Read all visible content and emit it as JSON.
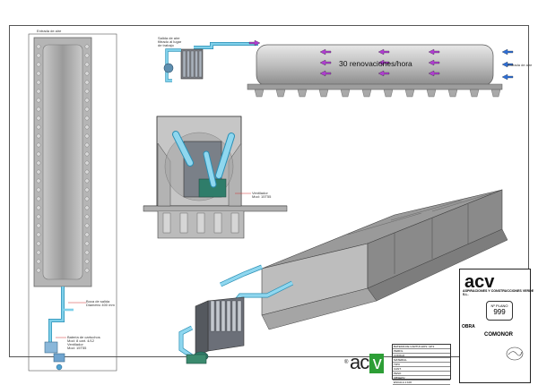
{
  "labels": {
    "entrada_left": "Entrada de aire",
    "salida_aire": "Salida de aire",
    "filtrado": "filtrado al lugar",
    "de_trabajo": "de trabajo",
    "renovaciones": "30 renovaciones/hora",
    "entrada_right": "Entrada de aire",
    "boca_salida_1": "Boca de salida",
    "boca_salida_2": "Diametro 400 mm",
    "batería_1": "Bateria de cartuchos",
    "batería_2": "Mod: 8 cart. 4/12",
    "batería_3": "Ventilador",
    "batería_4": "Mod: 15T55",
    "ventilador_mid_1": "Ventilador",
    "ventilador_mid_2": "Mod: 15T55"
  },
  "logo": {
    "text": "ac",
    "v": "v",
    "reg": "®"
  },
  "title_block": {
    "logo": "acv",
    "company": "ASPIRACIONES Y CONSTRUCCIONES VERDE S.L.",
    "plano_label": "Nº PLANO",
    "plano_number": "999",
    "obra_label": "OBRA",
    "obra_name": "COMONOR"
  },
  "table_rows": [
    "BATERIA DE CARTUCHOS / ET2",
    "PERFIL",
    "CODIGO",
    "MATERIAL",
    "TIPO",
    "CANT.",
    "PESO",
    "OBSERV.",
    "ESCALA 1:100"
  ],
  "colors": {
    "duct": "#7fd0ea",
    "duct_dark": "#2a8fb5",
    "concrete": "#9a9a9a",
    "concrete_light": "#c8c8c8",
    "concrete_dark": "#6e6e6e",
    "arrow_blue": "#2f6fd6",
    "arrow_purple": "#b03fd0",
    "accent_green": "#2d9e36",
    "dim_red": "#d03030"
  }
}
